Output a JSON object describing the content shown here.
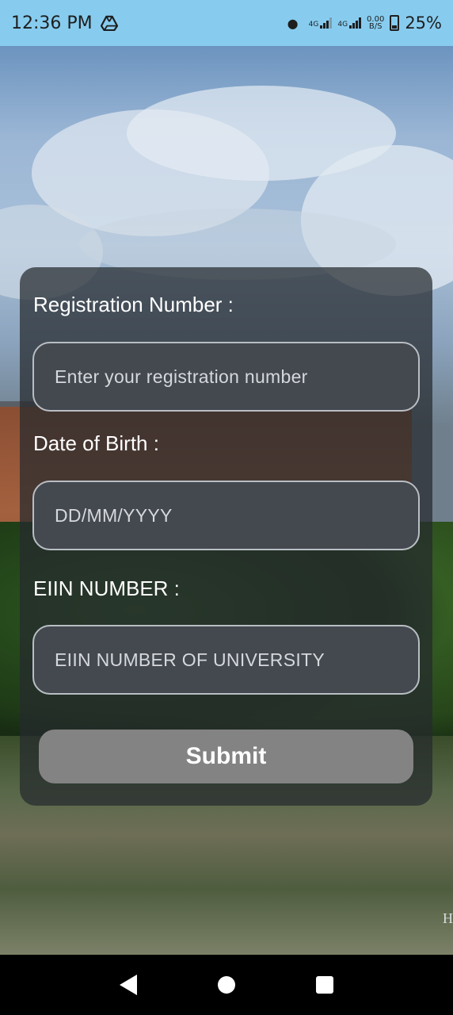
{
  "status_bar": {
    "time": "12:36 PM",
    "network_1": "4G",
    "network_2": "4G",
    "net_speed_value": "0.00",
    "net_speed_unit": "B/S",
    "battery": "25%"
  },
  "form": {
    "registration_label": "Registration Number :",
    "registration_placeholder": "Enter your registration number",
    "dob_label": "Date of Birth :",
    "dob_placeholder": "DD/MM/YYYY",
    "eiin_label": "EIIN NUMBER :",
    "eiin_placeholder": "EIIN NUMBER OF UNIVERSITY",
    "submit_label": "Submit"
  },
  "background": {
    "edge_text": "H"
  },
  "icons": {
    "status": [
      "drive-icon",
      "dot-icon",
      "signal-icon",
      "battery-icon"
    ],
    "navigation": [
      "back-icon",
      "home-icon",
      "recents-icon"
    ]
  },
  "colors": {
    "status_bar": "#87ccef",
    "card": "#26292e",
    "input_bg": "#44484f",
    "button": "#838383"
  }
}
